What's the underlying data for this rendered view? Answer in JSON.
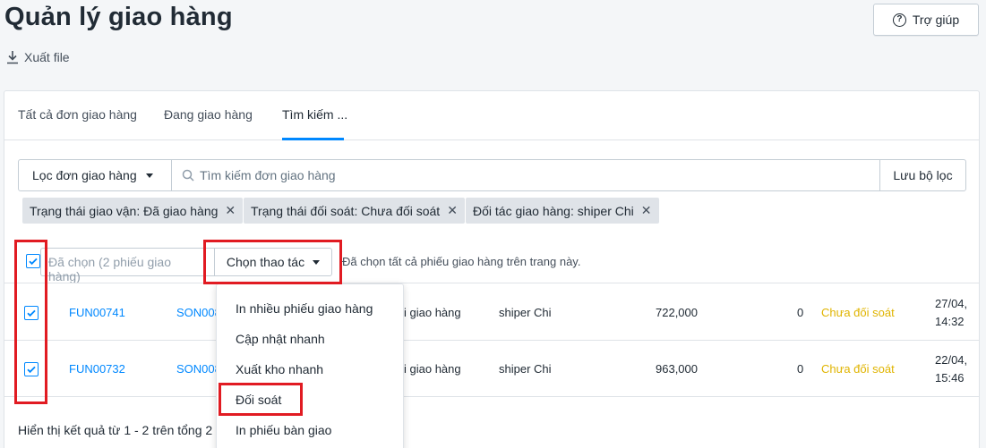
{
  "page": {
    "title": "Quản lý giao hàng",
    "export_label": "Xuất file",
    "help_label": "Trợ giúp"
  },
  "tabs": [
    {
      "label": "Tất cả đơn giao hàng"
    },
    {
      "label": "Đang giao hàng"
    },
    {
      "label": "Tìm kiếm ..."
    }
  ],
  "filter": {
    "dropdown_label": "Lọc đơn giao hàng",
    "search_placeholder": "Tìm kiếm đơn giao hàng",
    "save_label": "Lưu bộ lọc"
  },
  "chips": [
    {
      "label": "Trạng thái giao vận: Đã giao hàng"
    },
    {
      "label": "Trạng thái đối soát: Chưa đối soát"
    },
    {
      "label": "Đối tác giao hàng: shiper Chi"
    }
  ],
  "bulk": {
    "selected_label": "Đã chọn (2 phiếu giao hàng)",
    "action_label": "Chọn thao tác",
    "select_all_note": "Đã chọn tất cả phiếu giao hàng trên trang này."
  },
  "rows": [
    {
      "code": "FUN00741",
      "order": "SON008",
      "status_ship": "i giao hàng",
      "partner": "shiper Chi",
      "amount": "722,000",
      "fee": "0",
      "reconcile": "Chưa đối soát",
      "date": "27/04,",
      "time": "14:32"
    },
    {
      "code": "FUN00732",
      "order": "SON008",
      "status_ship": "i giao hàng",
      "partner": "shiper Chi",
      "amount": "963,000",
      "fee": "0",
      "reconcile": "Chưa đối soát",
      "date": "22/04,",
      "time": "15:46"
    }
  ],
  "footer": {
    "text": "Hiển thị kết quả từ 1 - 2 trên tổng 2"
  },
  "menu": [
    {
      "label": "In nhiều phiếu giao hàng"
    },
    {
      "label": "Cập nhật nhanh"
    },
    {
      "label": "Xuất kho nhanh"
    },
    {
      "label": "Đối soát"
    },
    {
      "label": "In phiếu bàn giao"
    }
  ],
  "colors": {
    "accent": "#0088ff",
    "highlight": "#e11b22",
    "warning": "#e0b400"
  }
}
